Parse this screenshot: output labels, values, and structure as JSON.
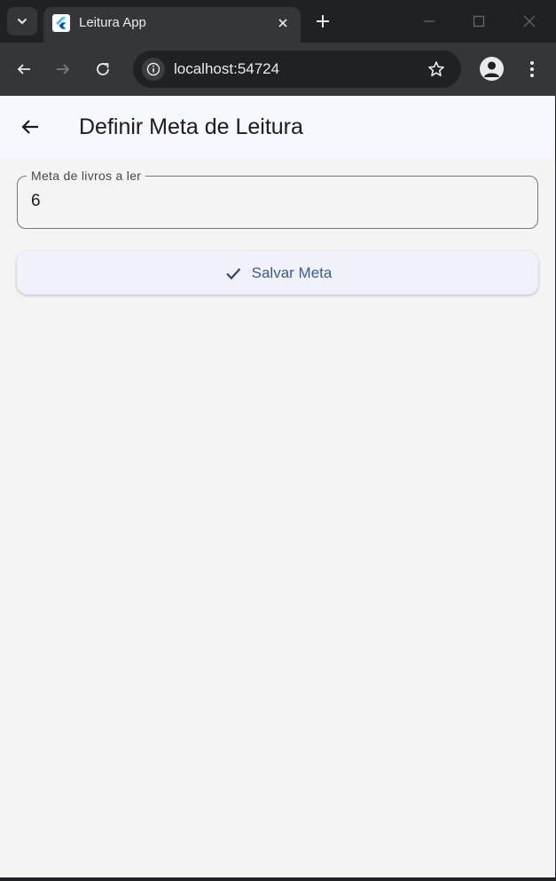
{
  "browser": {
    "tab_title": "Leitura App",
    "url": "localhost:54724",
    "icons": {
      "tab_search": "chevron-down-icon",
      "favicon": "flutter-icon",
      "tab_close": "close-icon",
      "new_tab": "plus-icon",
      "minimize": "minimize-icon",
      "maximize": "maximize-icon",
      "window_close": "close-icon",
      "back": "arrow-left-icon",
      "forward": "arrow-right-icon",
      "reload": "reload-icon",
      "site_info": "info-icon",
      "bookmark": "star-icon",
      "profile": "person-icon",
      "menu": "more-vert-icon"
    }
  },
  "app": {
    "appbar": {
      "title": "Definir Meta de Leitura",
      "back_icon": "arrow-left-icon"
    },
    "goal_field": {
      "label": "Meta de livros a ler",
      "value": "6"
    },
    "save_button": {
      "label": "Salvar Meta",
      "icon": "check-icon"
    },
    "colors": {
      "accent": "#3d5c8a",
      "background": "#f4f4f5",
      "appbar": "#f7f8fd",
      "browser_frame": "#202124"
    }
  }
}
